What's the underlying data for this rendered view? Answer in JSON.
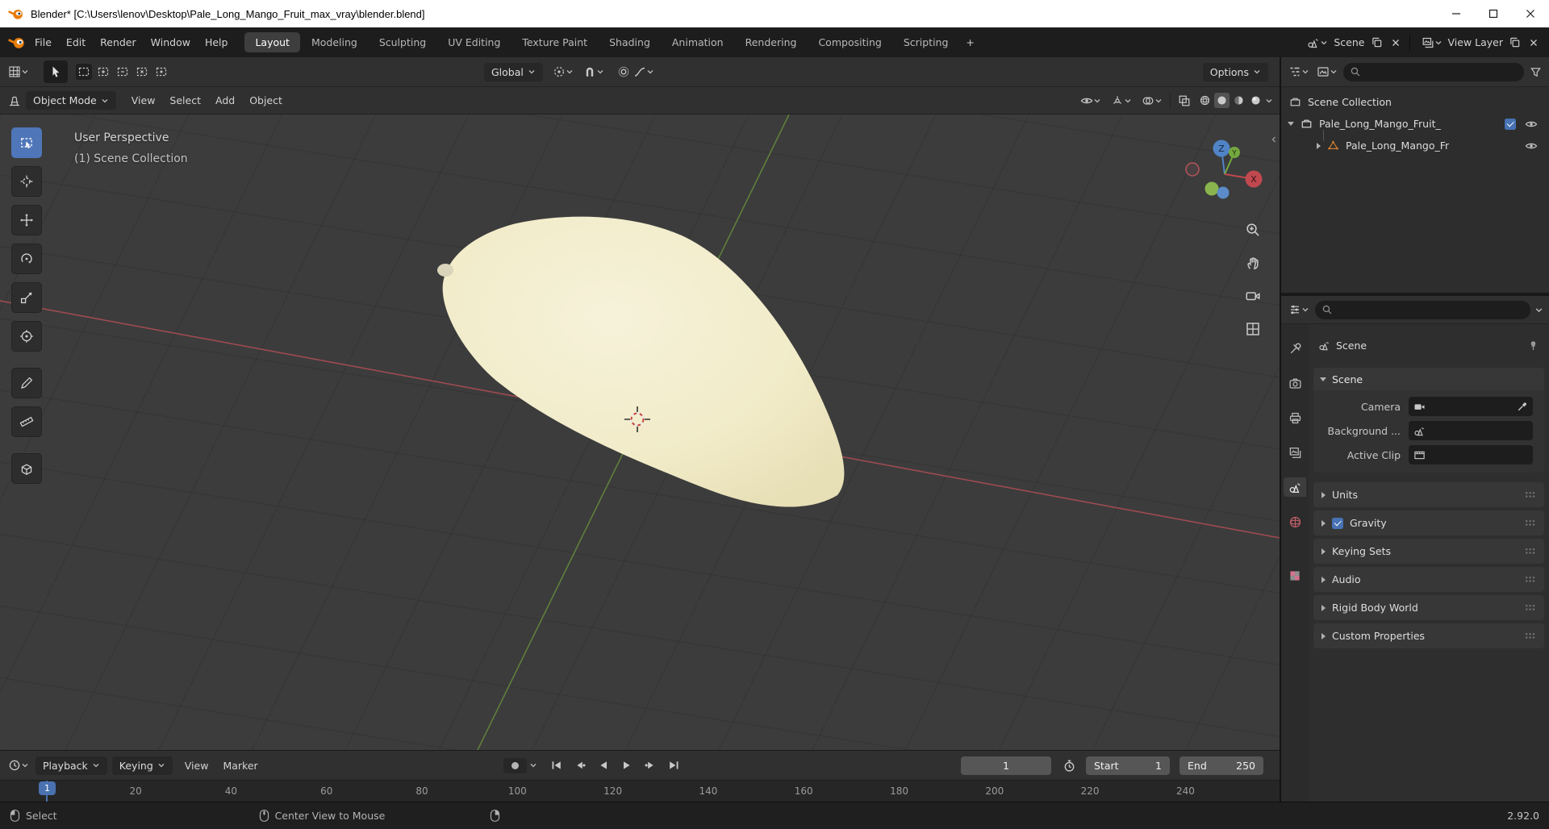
{
  "window": {
    "title": "Blender* [C:\\Users\\lenov\\Desktop\\Pale_Long_Mango_Fruit_max_vray\\blender.blend]"
  },
  "topbar": {
    "menus": [
      "File",
      "Edit",
      "Render",
      "Window",
      "Help"
    ],
    "tabs": [
      "Layout",
      "Modeling",
      "Sculpting",
      "UV Editing",
      "Texture Paint",
      "Shading",
      "Animation",
      "Rendering",
      "Compositing",
      "Scripting"
    ],
    "add_tab": "+",
    "scene_label": "Scene",
    "view_layer_label": "View Layer"
  },
  "tool_header": {
    "orientation": "Global",
    "options": "Options"
  },
  "viewport": {
    "header": {
      "mode": "Object Mode",
      "menus": [
        "View",
        "Select",
        "Add",
        "Object"
      ]
    },
    "overlay": {
      "line1": "User Perspective",
      "line2": "(1) Scene Collection"
    },
    "gizmo": {
      "x": "X",
      "y": "Y",
      "z": "Z"
    },
    "object_color": "#f1ebc8",
    "axis_x_color": "#9d4b51",
    "axis_y_color": "#5f7f3c"
  },
  "outliner": {
    "rows": [
      {
        "label": "Scene Collection"
      },
      {
        "label": "Pale_Long_Mango_Fruit_"
      },
      {
        "label": "Pale_Long_Mango_Fr"
      }
    ]
  },
  "properties": {
    "breadcrumb": "Scene",
    "panel_title": "Scene",
    "fields": [
      {
        "label": "Camera"
      },
      {
        "label": "Background ..."
      },
      {
        "label": "Active Clip"
      }
    ],
    "sections": [
      "Units",
      "Gravity",
      "Keying Sets",
      "Audio",
      "Rigid Body World",
      "Custom Properties"
    ]
  },
  "timeline": {
    "playback": "Playback",
    "keying": "Keying",
    "view": "View",
    "marker": "Marker",
    "frame": "1",
    "start_label": "Start",
    "start_value": "1",
    "end_label": "End",
    "end_value": "250",
    "playhead": "1",
    "ruler_ticks": [
      "20",
      "40",
      "60",
      "80",
      "100",
      "120",
      "140",
      "160",
      "180",
      "200",
      "220",
      "240"
    ]
  },
  "status": {
    "select_hint": "Select",
    "center_hint": "Center View to Mouse",
    "version": "2.92.0"
  }
}
